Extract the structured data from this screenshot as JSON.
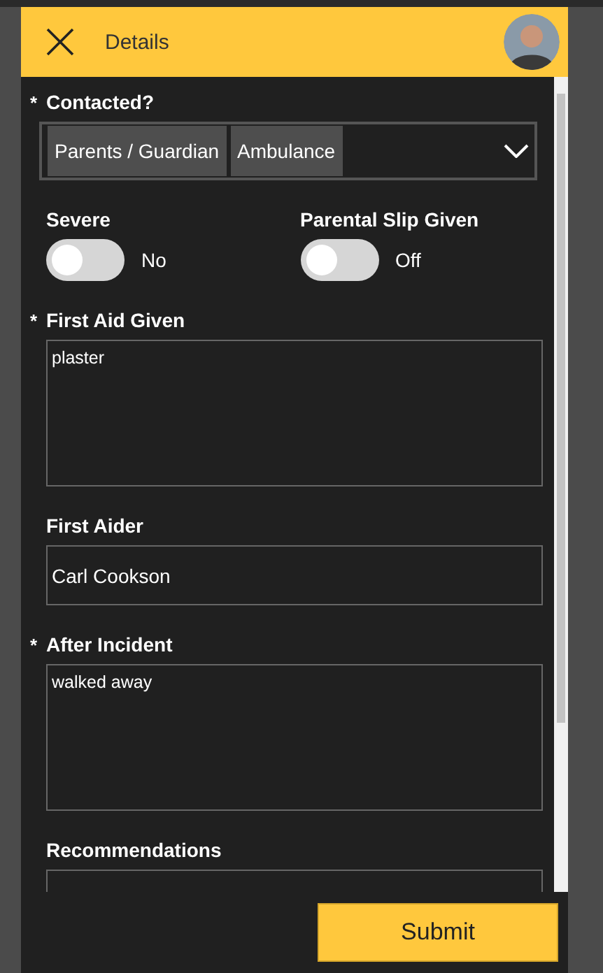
{
  "header": {
    "title": "Details"
  },
  "fields": [
    {
      "kind": "multiselect",
      "label": "Contacted?",
      "required_mark": "*",
      "chips": [
        "Parents / Guardian",
        "Ambulance"
      ]
    },
    {
      "kind": "toggles",
      "toggles": [
        {
          "label": "Severe",
          "on": false,
          "state_text": "No"
        },
        {
          "label": "Parental Slip Given",
          "on": false,
          "state_text": "Off"
        }
      ]
    },
    {
      "kind": "textarea",
      "label": "First Aid Given",
      "required_mark": "*",
      "value": "plaster"
    },
    {
      "kind": "text",
      "label": "First Aider",
      "value": "Carl Cookson"
    },
    {
      "kind": "textarea",
      "label": "After Incident",
      "required_mark": "*",
      "value": "walked away"
    },
    {
      "kind": "text",
      "label": "Recommendations"
    }
  ],
  "submit": "Submit"
}
